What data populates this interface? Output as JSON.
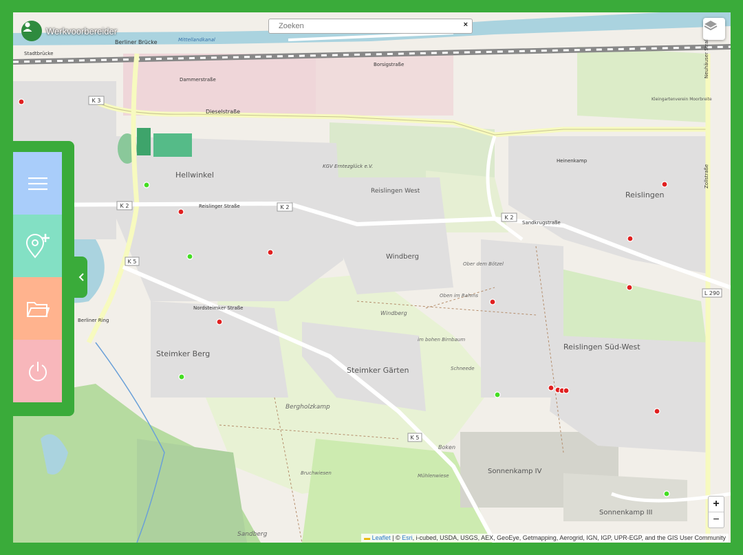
{
  "app": {
    "user_name": "Werkvoorbereider",
    "accent_color": "#3aab3a"
  },
  "search": {
    "placeholder": "Zoeken",
    "value": "Zoeken",
    "clear_label": "×"
  },
  "side_menu": {
    "items": [
      {
        "name": "menu",
        "icon": "hamburger-icon",
        "color": "#a9cdfa"
      },
      {
        "name": "add-location",
        "icon": "location-plus-icon",
        "color": "#83e0c4"
      },
      {
        "name": "open-folder",
        "icon": "folder-icon",
        "color": "#ffb38e"
      },
      {
        "name": "logout",
        "icon": "power-icon",
        "color": "#f8b7bb"
      }
    ],
    "collapse_icon": "chevron-left-icon"
  },
  "map_controls": {
    "zoom_in": "+",
    "zoom_out": "−",
    "layers_icon": "layers-icon"
  },
  "attribution": {
    "leaflet": "Leaflet",
    "sep": " | © ",
    "esri": "Esri",
    "rest": ", i-cubed, USDA, USGS, AEX, GeoEye, Getmapping, Aerogrid, IGN, IGP, UPR-EGP, and the GIS User Community"
  },
  "map_labels": {
    "districts": [
      "Hellwinkel",
      "Reislingen West",
      "Windberg",
      "Reislingen",
      "Reislingen Süd-West",
      "Steimker Berg",
      "Steimker Gärten",
      "Sonnenkamp IV",
      "Sonnenkamp III"
    ],
    "streets": [
      "Dieselstraße",
      "Reislinger Straße",
      "Sandkrugstraße",
      "Nordsteimker Straße",
      "Berliner Ring",
      "Zollstraße",
      "Neuhäuser Straße",
      "Borsigstraße",
      "Dammerstraße",
      "Heinenkamp"
    ],
    "places": [
      "Bergholzkamp",
      "Windberg",
      "Boken",
      "Sandberg",
      "Mühlenwiese",
      "Bruchwiesen",
      "Stadtbrücke",
      "Berliner Brücke",
      "Mittellandkanal",
      "KGV Erntezglück e.V.",
      "Ober dem Bötzel",
      "Oben im Rahms",
      "im bohen Birnbaum",
      "Schneede",
      "Kleingartenverein Moorbreite"
    ],
    "roads": [
      "K 2",
      "K 3",
      "K 5",
      "L 290"
    ]
  },
  "markers": {
    "red_count": 13,
    "green_count": 5,
    "red_color": "#e02020",
    "green_color": "#44dd22"
  }
}
